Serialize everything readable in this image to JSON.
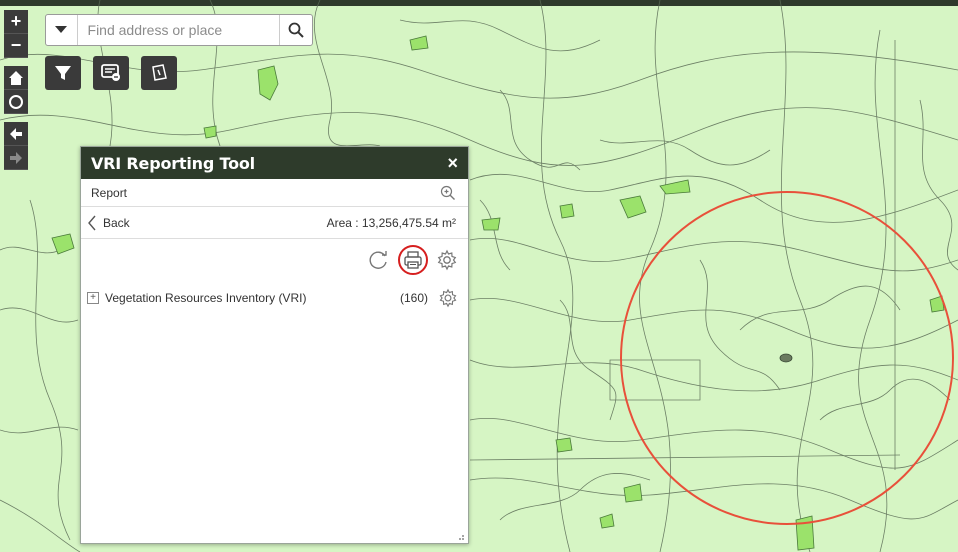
{
  "search": {
    "placeholder": "Find address or place"
  },
  "nav": {
    "zoom_in": "+",
    "zoom_out": "−"
  },
  "tools": {
    "icons": [
      "filter-icon",
      "layer-list-icon",
      "draw-area-icon"
    ]
  },
  "panel": {
    "title": "VRI Reporting Tool",
    "close_label": "×",
    "report_label": "Report",
    "back_label": "Back",
    "area_text": "Area : 13,256,475.54 m²",
    "layers": [
      {
        "name": "Vegetation Resources Inventory (VRI)",
        "count": "(160)"
      }
    ]
  },
  "colors": {
    "map_background": "#d6f5c4",
    "polygon_outline": "#4a5a46",
    "highlight_fill": "#9be26b",
    "selection_circle": "#e8503a",
    "panel_header": "#2e3b2b",
    "print_highlight": "#d61f1f"
  }
}
